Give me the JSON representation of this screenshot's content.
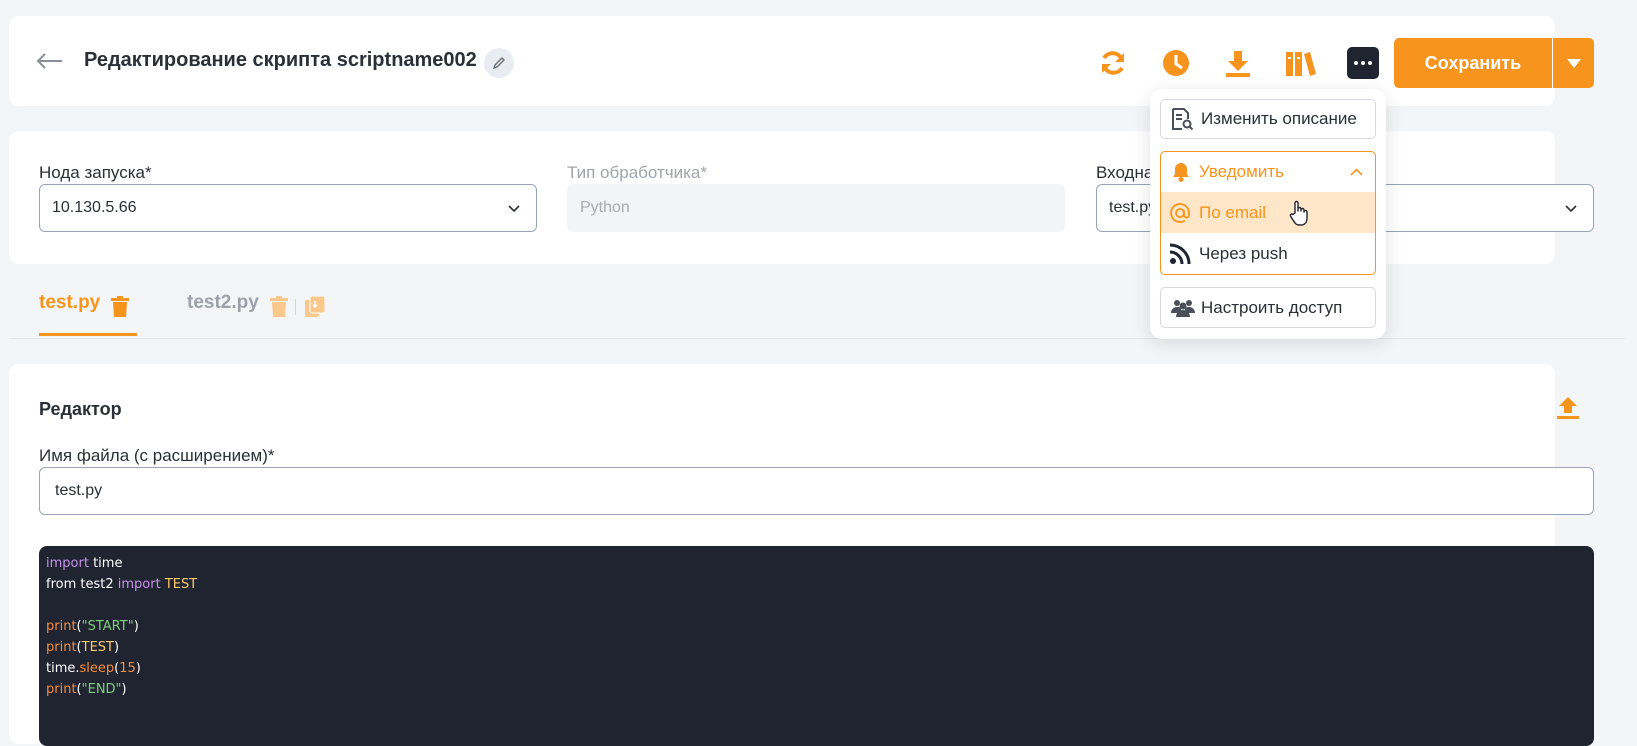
{
  "header": {
    "title": "Редактирование скрипта scriptname002",
    "save_label": "Сохранить"
  },
  "form": {
    "node_label": "Нода запуска*",
    "node_value": "10.130.5.66",
    "handler_label": "Тип обработчика*",
    "handler_value": "Python",
    "input_label": "Входна",
    "input_value": "test.py"
  },
  "tabs": [
    {
      "label": "test.py"
    },
    {
      "label": "test2.py"
    }
  ],
  "editor": {
    "title": "Редактор",
    "filename_label": "Имя файла (с расширением)*",
    "filename_value": "test.py"
  },
  "code": {
    "l1_kw": "import",
    "l1_rest": " time",
    "l2_a": "from test2 ",
    "l2_kw": "import",
    "l2_cls": " TEST",
    "l4_fn": "print",
    "l4_str": "\"START\"",
    "l5_fn": "print",
    "l5_cls": "TEST",
    "l6_a": "time",
    "l6_fn": "sleep",
    "l6_num": "15",
    "l7_fn": "print",
    "l7_str": "\"END\""
  },
  "dropdown": {
    "change_desc": "Изменить описание",
    "notify": "Уведомить",
    "by_email": "По email",
    "via_push": "Через push",
    "access": "Настроить доступ"
  },
  "colors": {
    "accent": "#f7941d",
    "dark": "#1f2430",
    "highlight": "#fde7c8"
  }
}
